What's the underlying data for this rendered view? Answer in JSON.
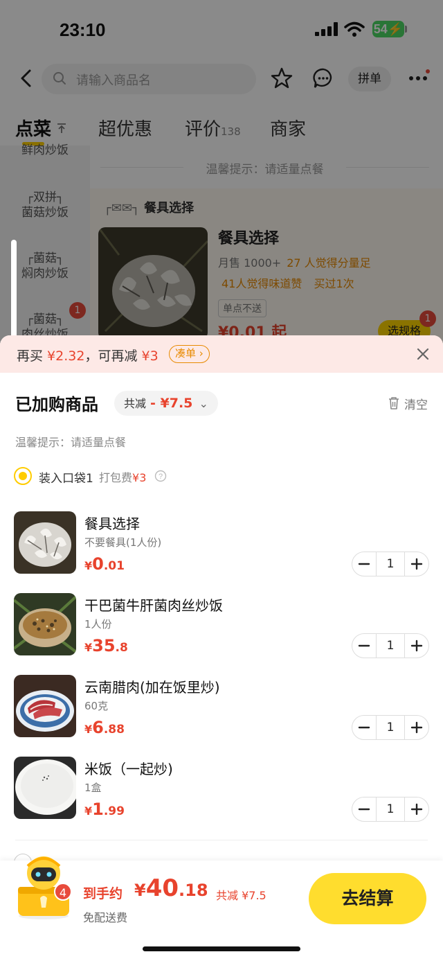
{
  "status": {
    "time": "23:10",
    "battery": "54"
  },
  "header": {
    "search_placeholder": "请输入商品名",
    "pindan": "拼单"
  },
  "tabs": [
    {
      "label": "点菜"
    },
    {
      "label": "超优惠"
    },
    {
      "label": "评价",
      "count": "138"
    },
    {
      "label": "商家"
    }
  ],
  "sidebar": {
    "items": [
      {
        "label": "鲜肉炒饭"
      },
      {
        "label": "┌双拼┐\n菌菇炒饭"
      },
      {
        "label": "┌菌菇┐\n焖肉炒饭"
      },
      {
        "label": "┌菌菇┐\n肉丝炒饭"
      }
    ],
    "badge": "1"
  },
  "menu": {
    "hint": "温馨提示：请适量点餐",
    "category_title": "餐具选择",
    "product": {
      "name": "餐具选择",
      "sales": "月售 1000+",
      "tag1": "27 人觉得分量足",
      "tag2": "41人觉得味道赞",
      "tag3": "买过1次",
      "single": "单点不送",
      "price": "¥0.01 起",
      "spec_button": "选规格",
      "spec_badge": "1"
    }
  },
  "promo": {
    "text_prefix": "再买 ",
    "amount1": "¥2.32",
    "text_mid": "，可再减 ",
    "amount2": "¥3",
    "button": "凑单 ›"
  },
  "cart": {
    "title": "已加购商品",
    "discount_label": "共减",
    "discount_value": "- ¥7.5",
    "clear": "清空",
    "hint": "温馨提示：请适量点餐",
    "bag_label": "装入口袋1",
    "bag_fee_label": "打包费",
    "bag_fee": "¥3",
    "items": [
      {
        "name": "餐具选择",
        "spec": "不要餐具(1人份)",
        "price_int": "0",
        "price_dec": ".01",
        "qty": "1"
      },
      {
        "name": "干巴菌牛肝菌肉丝炒饭",
        "spec": "1人份",
        "price_int": "35",
        "price_dec": ".8",
        "qty": "1"
      },
      {
        "name": "云南腊肉(加在饭里炒)",
        "spec": "60克",
        "price_int": "6",
        "price_dec": ".88",
        "qty": "1"
      },
      {
        "name": "米饭（一起炒)",
        "spec": "1盒",
        "price_int": "1",
        "price_dec": ".99",
        "qty": "1"
      }
    ]
  },
  "bar": {
    "count": "4",
    "total_label": "到手约",
    "total_int": "40",
    "total_dec": ".18",
    "saved": "共减 ¥7.5",
    "delivery": "免配送费",
    "checkout": "去结算"
  },
  "currency": "¥",
  "colors": {
    "accent": "#ffdd2e",
    "price": "#e8432d",
    "badge": "#e84b3c"
  }
}
